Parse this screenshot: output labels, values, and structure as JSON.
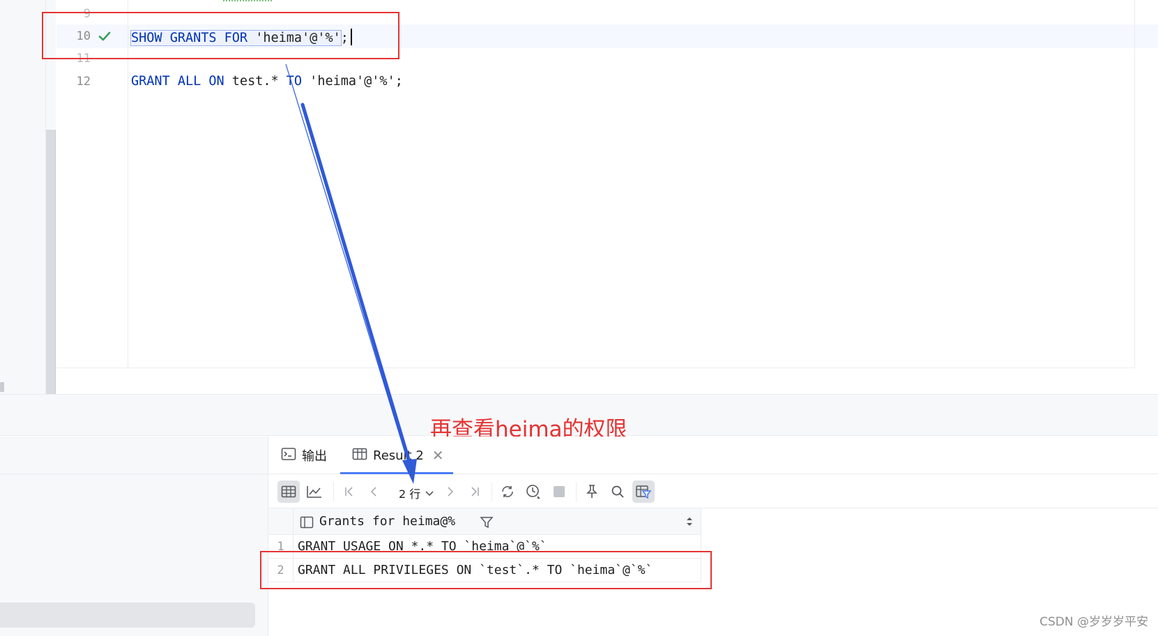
{
  "editor": {
    "lines": [
      {
        "number": "9",
        "text": ""
      },
      {
        "number": "10",
        "status": "check-icon",
        "code": {
          "kw1": "SHOW GRANTS FOR",
          "str": " 'heima'@'%'",
          "end": ";"
        }
      },
      {
        "number": "11",
        "text": ""
      },
      {
        "number": "12",
        "code": {
          "kw1": "GRANT ALL ON",
          "mid": " test.* ",
          "kw2": "TO",
          "str": " 'heima'@'%';"
        }
      }
    ]
  },
  "annotation": "再查看heima的权限",
  "panel": {
    "tabs": [
      {
        "label": "输出",
        "icon": "terminal-icon"
      },
      {
        "label": "Result 2",
        "icon": "table-icon",
        "closable": true
      }
    ],
    "toolbar": {
      "rows_label": "2 行"
    },
    "grid": {
      "column": "Grants for heima@%",
      "rows": [
        {
          "n": "1",
          "value": "GRANT USAGE ON *.* TO `heima`@`%`"
        },
        {
          "n": "2",
          "value": "GRANT ALL PRIVILEGES ON `test`.* TO `heima`@`%`"
        }
      ]
    }
  },
  "watermark": "CSDN @岁岁岁平安",
  "colors": {
    "accent": "#4a7cf3",
    "annotation": "#e53333",
    "keyword": "#0033b3",
    "check": "#3a9e5c"
  }
}
